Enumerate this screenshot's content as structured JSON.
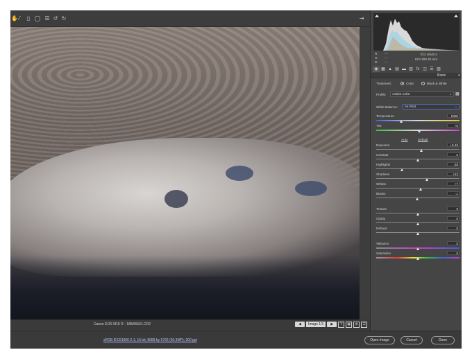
{
  "toolbar": {
    "tools": [
      "hand-tool",
      "white-balance-tool",
      "crop-tool",
      "spot-removal-tool",
      "list-tool",
      "rotate-left-tool",
      "rotate-right-tool"
    ],
    "open_in_photoshop_icon": "export-icon"
  },
  "preview": {
    "camera_info": "Canon EOS 5DS R  -  18BA5501.CR2",
    "image_count": "Image 1/1",
    "prev_label": "◀",
    "next_label": "▶",
    "view_buttons": [
      "Y",
      "▣",
      "⊕",
      "☰"
    ]
  },
  "bottom": {
    "workflow_link": "sRGB IEC61966-2.1; 16 bit; 8688 by 5792 (50.3MP); 300 ppi",
    "open_image": "Open Image",
    "cancel": "Cancel",
    "done": "Done"
  },
  "histogram": {
    "rgb": [
      {
        "label": "R:",
        "value": "---"
      },
      {
        "label": "G:",
        "value": "---"
      },
      {
        "label": "B:",
        "value": "---"
      }
    ],
    "aperture_shutter": "f/11   1/640 s",
    "iso_focal": "ISO 200   40 mm"
  },
  "panel": {
    "tabs": [
      "◉",
      "▦",
      "▲",
      "▤",
      "▬",
      "▥",
      "fx",
      "◫",
      "☰",
      "▧"
    ],
    "title": "Basic",
    "menu": "≡",
    "treatment_label": "Treatment:",
    "treatment_color": "Color",
    "treatment_bw": "Black & White",
    "profile_label": "Profile:",
    "profile_value": "Adobe Color",
    "white_balance_label": "White Balance:",
    "white_balance_value": "As Shot",
    "auto": "Auto",
    "default": "Default"
  },
  "sliders": {
    "temperature": {
      "label": "Temperature",
      "value": "5300",
      "position": 0.3
    },
    "tint": {
      "label": "Tint",
      "value": "+6",
      "position": 0.52
    },
    "exposure": {
      "label": "Exposure",
      "value": "+0.45",
      "position": 0.54
    },
    "contrast": {
      "label": "Contrast",
      "value": "0",
      "position": 0.5
    },
    "highlights": {
      "label": "Highlights",
      "value": "-38",
      "position": 0.31
    },
    "shadows": {
      "label": "Shadows",
      "value": "+22",
      "position": 0.61
    },
    "whites": {
      "label": "Whites",
      "value": "+7",
      "position": 0.53
    },
    "blacks": {
      "label": "Blacks",
      "value": "-1",
      "position": 0.49
    },
    "texture": {
      "label": "Texture",
      "value": "0",
      "position": 0.5
    },
    "clarity": {
      "label": "Clarity",
      "value": "0",
      "position": 0.5
    },
    "dehaze": {
      "label": "Dehaze",
      "value": "0",
      "position": 0.5
    },
    "vibrance": {
      "label": "Vibrance",
      "value": "0",
      "position": 0.5
    },
    "saturation": {
      "label": "Saturation",
      "value": "0",
      "position": 0.5
    }
  }
}
